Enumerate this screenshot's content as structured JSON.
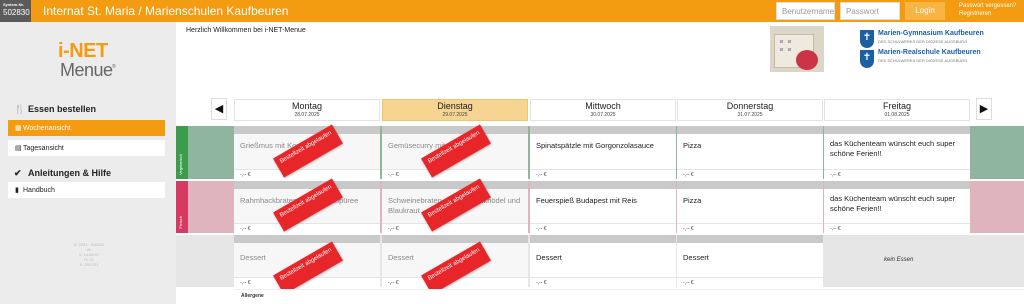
{
  "topbar": {
    "system_label": "System-Nr.",
    "system_number": "502830",
    "title": "Internat St. Maria / Marienschulen Kaufbeuren",
    "username_placeholder": "Benutzername",
    "password_placeholder": "Passwort",
    "login_label": "Login",
    "forgot_password": "Passwort vergessen?",
    "register": "Registrieren",
    "accent_color": "#f39c12"
  },
  "sidebar": {
    "logo_top": "i-NET",
    "logo_bottom": "Menue",
    "logo_reg": "®",
    "section_order": "Essen bestellen",
    "item_week": "Wochenansicht",
    "item_day": "Tagesansicht",
    "section_help": "Anleitungen & Hilfe",
    "item_manual": "Handbuch",
    "meta_lines": [
      "S: 2231 - 502830",
      "W:",
      "V: 14.08.07",
      "H: 01",
      "S: 2SS721"
    ]
  },
  "header": {
    "welcome": "Herzlich Willkommen bei i-NET-Menue",
    "school1_name": "Marien-Gymnasium Kaufbeuren",
    "school1_sub": "DES SCHULWERKS DER DIÖZESE AUGSBURG",
    "school2_name": "Marien-Realschule Kaufbeuren",
    "school2_sub": "DES SCHULWERKS DER DIÖZESE AUGSBURG"
  },
  "days": [
    {
      "name": "Montag",
      "date": "28.07.2025"
    },
    {
      "name": "Dienstag",
      "date": "29.07.2025"
    },
    {
      "name": "Mittwoch",
      "date": "30.07.2025"
    },
    {
      "name": "Donnerstag",
      "date": "31.07.2025"
    },
    {
      "name": "Freitag",
      "date": "01.08.2025"
    }
  ],
  "bands": {
    "veg_label": "Vegetarisch",
    "veg_color": "#8fb4a0",
    "meat_label": "Fleisch",
    "meat_color": "#e0b4bc",
    "dessert_color": "#e6e6e6"
  },
  "stamp_text": "Bestellzeit abgelaufen",
  "menu": {
    "veg": [
      "Grießmus mit Kompott",
      "Gemüsecurry mit Reis",
      "Spinatspätzle mit Gorgonzolasauce",
      "Pizza",
      "das Küchenteam wünscht euch super schöne Ferien!!"
    ],
    "meat": [
      "Rahmhackbraten mit Kartoffelpüree",
      "Schweinebraten mit Semmelknödel und Blaukraut",
      "Feuerspieß Budapest mit Reis",
      "Pizza",
      "das Küchenteam wünscht euch super schöne Ferien!!"
    ],
    "dessert": [
      "Dessert",
      "Dessert",
      "Dessert",
      "Dessert"
    ],
    "no_food": "kein Essen",
    "price": "-,-- €"
  },
  "allergene": "Allergene"
}
